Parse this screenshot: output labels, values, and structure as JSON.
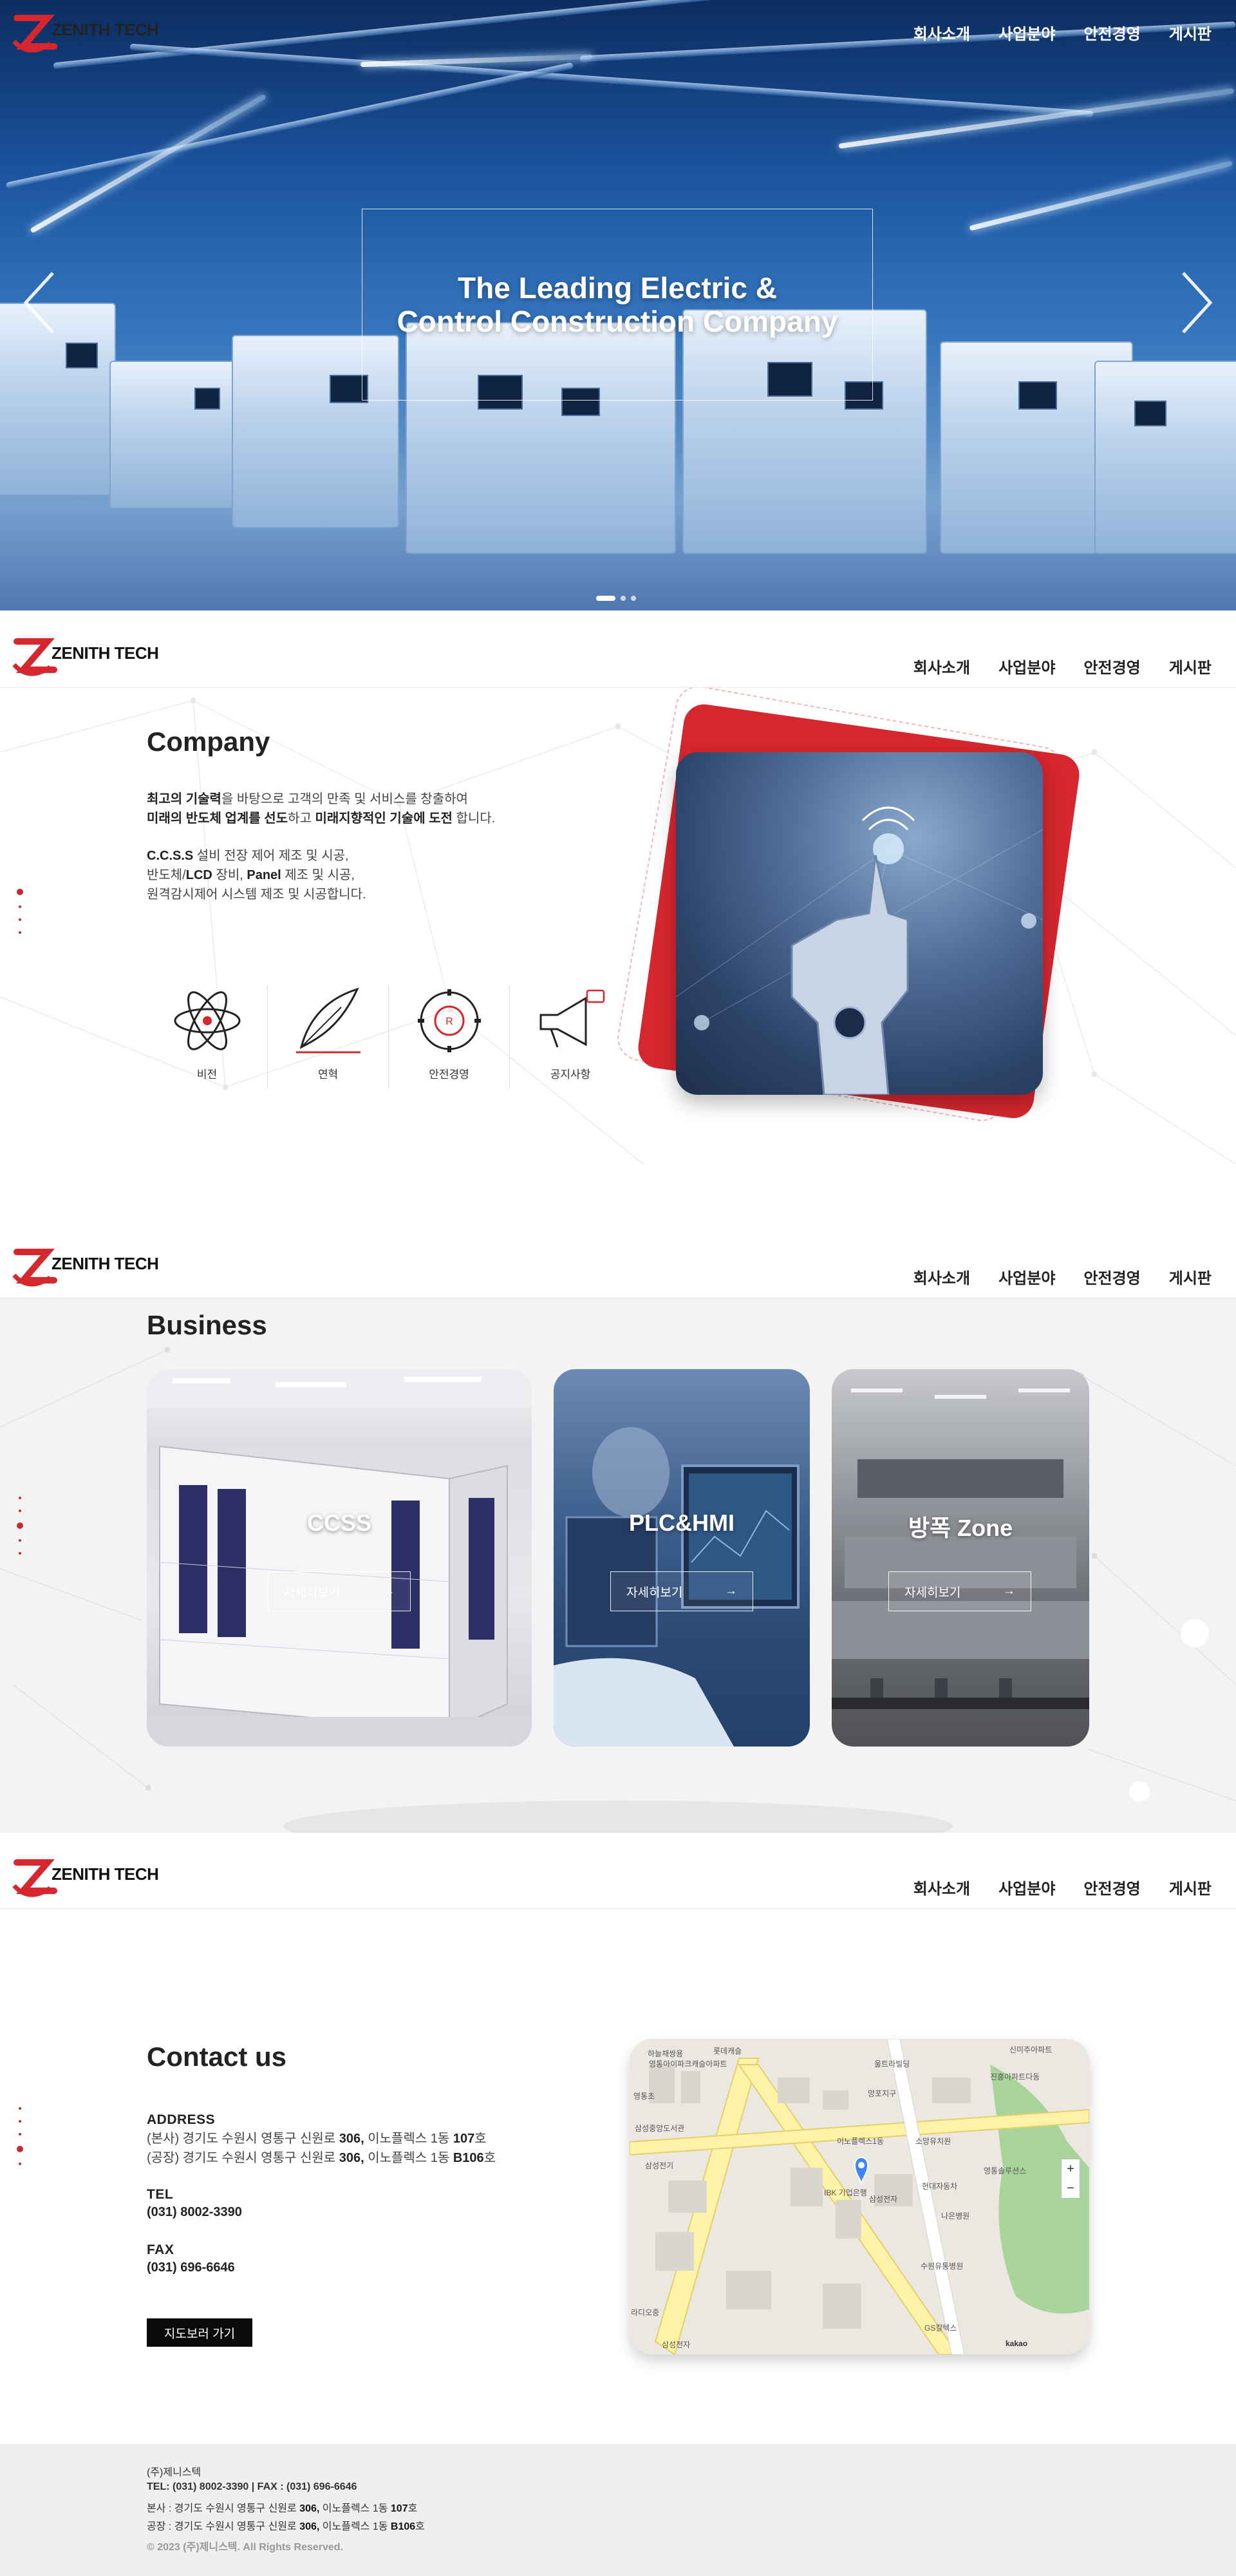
{
  "brand": {
    "name": "ZENITH TECH",
    "accent": "#d6262e"
  },
  "nav": [
    "회사소개",
    "사업분야",
    "안전경영",
    "게시판"
  ],
  "hero": {
    "title_line1": "The Leading Electric &",
    "title_line2": "Control Construction Company",
    "slides": 3,
    "active_slide": 1
  },
  "company": {
    "title": "Company",
    "p1_l1_b": "최고의 기술력",
    "p1_l1": "을 바탕으로 고객의 만족 및 서비스를 창출하여",
    "p1_l2_b1": "미래의 반도체 업계를 선도",
    "p1_l2_mid": "하고 ",
    "p1_l2_b2": "미래지향적인 기술에 도전",
    "p1_l2_end": " 합니다.",
    "p2_l1_b": "C.C.S.S",
    "p2_l1": " 설비 전장 제어 제조 및 시공,",
    "p2_l2_a": "반도체/",
    "p2_l2_b1": "LCD",
    "p2_l2_c": " 장비, ",
    "p2_l2_b2": "Panel",
    "p2_l2_d": " 제조 및 시공,",
    "p2_l3": "원격감시제어 시스템 제조 및 시공합니다.",
    "icons": [
      {
        "label": "비전",
        "icon": "atom-icon"
      },
      {
        "label": "연혁",
        "icon": "feather-pen-icon"
      },
      {
        "label": "안전경영",
        "icon": "safety-gear-icon"
      },
      {
        "label": "공지사항",
        "icon": "megaphone-icon"
      }
    ]
  },
  "business": {
    "title": "Business",
    "cards": [
      {
        "title": "CCSS",
        "more": "자세히보기"
      },
      {
        "title": "PLC&HMI",
        "more": "자세히보기"
      },
      {
        "title": "방폭 Zone",
        "more": "자세히보기"
      }
    ]
  },
  "contact": {
    "title": "Contact us",
    "address_label": "ADDRESS",
    "address_1a": "(본사) 경기도 수원시 영통구 신원로 ",
    "address_1b": "306,",
    "address_1c": " 이노플렉스 1동 ",
    "address_1d": "107",
    "address_1e": "호",
    "address_2a": "(공장) 경기도 수원시 영통구 신원로 ",
    "address_2b": "306,",
    "address_2c": " 이노플렉스 1동 ",
    "address_2d": "B106",
    "address_2e": "호",
    "tel_label": "TEL",
    "tel": "(031) 8002-3390",
    "fax_label": "FAX",
    "fax": "(031) 696-6646",
    "map_button": "지도보러 가기",
    "map_labels": [
      "하늘채쌍용",
      "신미주아파트",
      "영통아이파크캐슬아파트",
      "롯데캐슬",
      "울트라빌딩",
      "진흥아파트다동",
      "영통초",
      "망포지구",
      "삼성중앙도서관",
      "이노플렉스1동",
      "IBK 기업은행",
      "삼성전자",
      "삼성전기",
      "현대자동차",
      "영통솔루션스",
      "소망유치원",
      "나은병원",
      "수원유통병원",
      "GS칼텍스",
      "라디오중",
      "삼성전자",
      "kakao"
    ]
  },
  "footer": {
    "company": "(주)제니스텍",
    "tel_fax": "TEL: (031) 8002-3390 | FAX : (031) 696-6646",
    "hq_a": "본사 : 경기도 수원시 영통구 신원로 ",
    "hq_b": "306,",
    "hq_c": " 이노플렉스 1동 ",
    "hq_d": "107",
    "hq_e": "호",
    "factory_a": "공장 : 경기도 수원시 영통구 신원로 ",
    "factory_b": "306,",
    "factory_c": " 이노플렉스 1동 ",
    "factory_d": "B106",
    "factory_e": "호",
    "copyright": "© 2023 (주)제니스텍. All Rights Reserved."
  }
}
